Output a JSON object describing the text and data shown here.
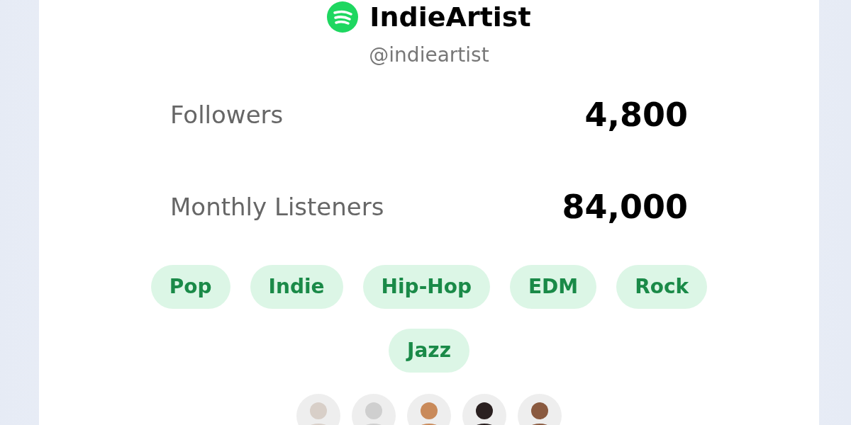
{
  "profile": {
    "name": "IndieArtist",
    "handle": "@indieartist"
  },
  "stats": [
    {
      "label": "Followers",
      "value": "4,800"
    },
    {
      "label": "Monthly Listeners",
      "value": "84,000"
    }
  ],
  "genres": [
    "Pop",
    "Indie",
    "Hip-Hop",
    "EDM",
    "Rock",
    "Jazz"
  ]
}
